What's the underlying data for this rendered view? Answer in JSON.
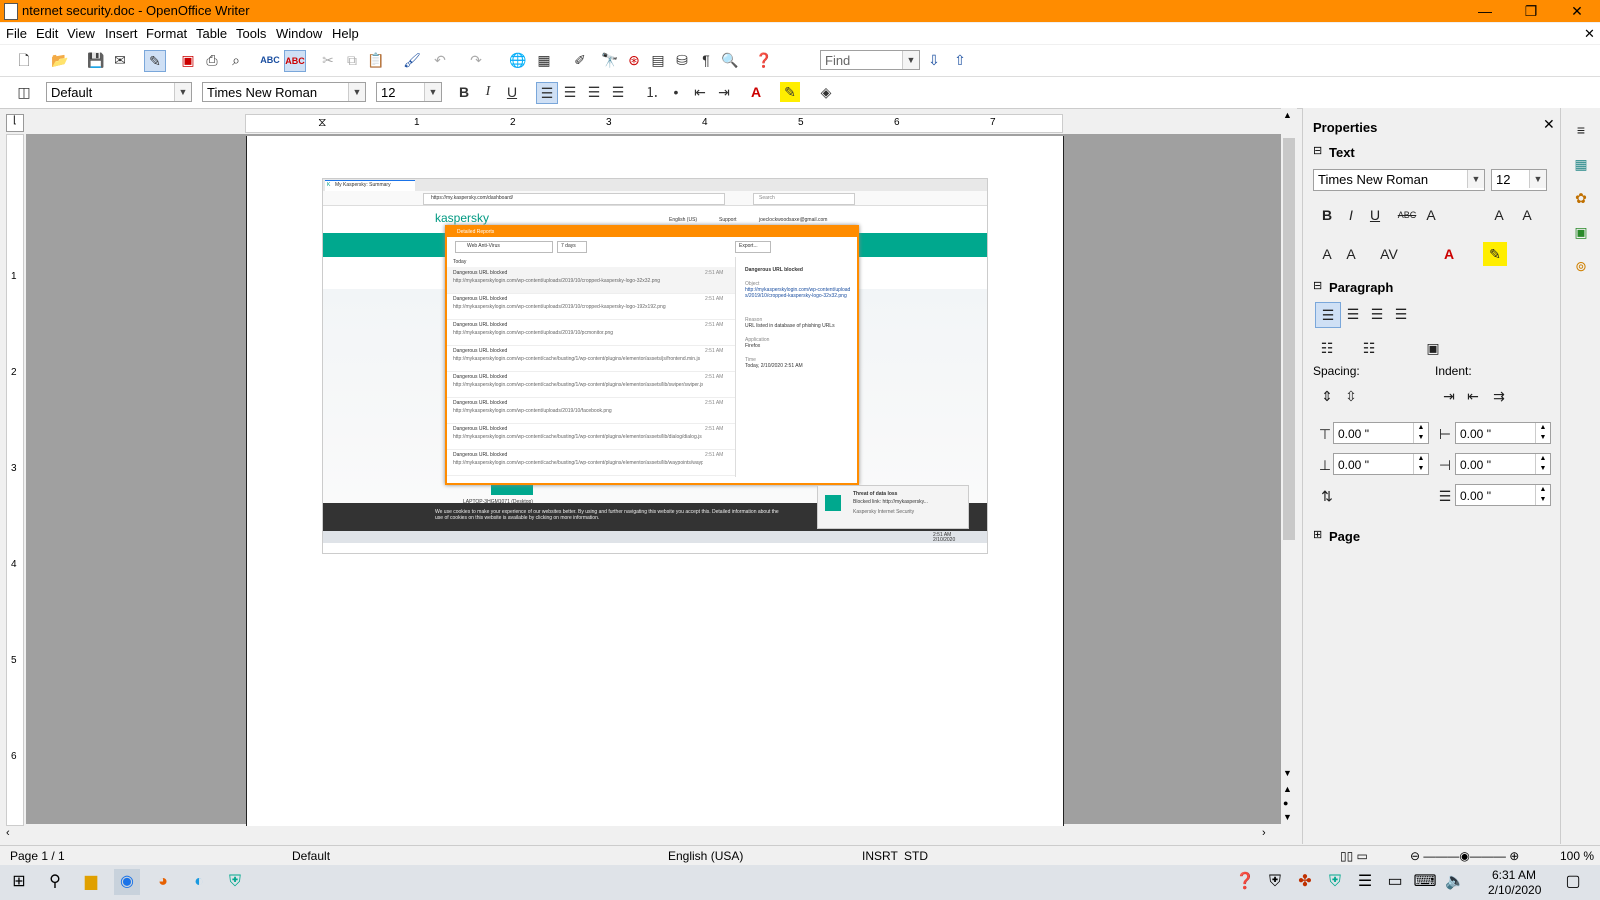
{
  "window": {
    "title": "nternet security.doc - OpenOffice Writer",
    "minimize": "—",
    "maximize": "❐",
    "close": "✕",
    "doc_close": "✕"
  },
  "menu": [
    "File",
    "Edit",
    "View",
    "Insert",
    "Format",
    "Table",
    "Tools",
    "Window",
    "Help"
  ],
  "toolbar1": {
    "find_placeholder": "Find"
  },
  "toolbar2": {
    "style": "Default",
    "font": "Times New Roman",
    "size": "12",
    "bold": "B",
    "italic": "I",
    "underline": "U"
  },
  "ruler": {
    "ticks": [
      "1",
      "2",
      "3",
      "4",
      "5",
      "6",
      "7"
    ],
    "vticks": [
      "1",
      "2",
      "3",
      "4",
      "5",
      "6"
    ]
  },
  "sidebar": {
    "title": "Properties",
    "text_section": "Text",
    "font": "Times New Roman",
    "size": "12",
    "paragraph_section": "Paragraph",
    "spacing_label": "Spacing:",
    "indent_label": "Indent:",
    "above": "0.00 \"",
    "below": "0.00 \"",
    "indent_before": "0.00 \"",
    "indent_after": "0.00 \"",
    "first_line": "0.00 \"",
    "page_section": "Page"
  },
  "statusbar": {
    "page": "Page 1 / 1",
    "style": "Default",
    "language": "English (USA)",
    "insert_mode": "INSRT",
    "selection_mode": "STD",
    "zoom": "100 %"
  },
  "taskbar": {
    "time": "6:31 AM",
    "date": "2/10/2020"
  },
  "embedded": {
    "tab": "My Kaspersky: Summary",
    "url": "https://my.kaspersky.com/dashboard/",
    "search": "Search",
    "brand": "kaspersky",
    "lang": "English (US)",
    "support": "Support",
    "account": "joeclockwoodsaxe@gmail.com",
    "dialog_title": "Detailed Reports",
    "filter": "Web Anti-Virus",
    "range": "7 days",
    "export": "Export...",
    "today": "Today",
    "items": [
      {
        "title": "Dangerous URL blocked",
        "url": "http://mykasperskylogin.com/wp-content/uploads/2019/10/cropped-kaspersky-logo-32x32.png",
        "time": "2:51 AM"
      },
      {
        "title": "Dangerous URL blocked",
        "url": "http://mykasperskylogin.com/wp-content/uploads/2019/10/cropped-kaspersky-logo-192x192.png",
        "time": "2:51 AM"
      },
      {
        "title": "Dangerous URL blocked",
        "url": "http://mykasperskylogin.com/wp-content/uploads/2019/10/pcmonitor.png",
        "time": "2:51 AM"
      },
      {
        "title": "Dangerous URL blocked",
        "url": "http://mykasperskylogin.com/wp-content/cache/busting/1/wp-content/plugins/elementor/assets/js/frontend.min.js",
        "time": "2:51 AM"
      },
      {
        "title": "Dangerous URL blocked",
        "url": "http://mykasperskylogin.com/wp-content/cache/busting/1/wp-content/plugins/elementor/assets/lib/swiper/swiper.js",
        "time": "2:51 AM"
      },
      {
        "title": "Dangerous URL blocked",
        "url": "http://mykasperskylogin.com/wp-content/uploads/2019/10/facebook.png",
        "time": "2:51 AM"
      },
      {
        "title": "Dangerous URL blocked",
        "url": "http://mykasperskylogin.com/wp-content/cache/busting/1/wp-content/plugins/elementor/assets/lib/dialog/dialog.js",
        "time": "2:51 AM"
      },
      {
        "title": "Dangerous URL blocked",
        "url": "http://mykasperskylogin.com/wp-content/cache/busting/1/wp-content/plugins/elementor/assets/lib/waypoints/waypoints.js",
        "time": "2:51 AM"
      }
    ],
    "detail_title": "Dangerous URL blocked",
    "detail_object_label": "Object",
    "detail_object": "http://mykasperskylogin.com/wp-content/uploads/2019/10/cropped-kaspersky-logo-32x32.png",
    "detail_reason_label": "Reason",
    "detail_reason": "URL listed in database of phishing URLs",
    "detail_app_label": "Application",
    "detail_app": "Firefox",
    "detail_time_label": "Time",
    "detail_time": "Today, 2/10/2020 2:51 AM",
    "laptop": "LAPTOP-3HGM1071 (Desktop)",
    "cookie": "We use cookies to make your experience of our websites better. By using and further navigating this website you accept this. Detailed information about the use of cookies on this website is available by clicking on more information.",
    "toast_title": "Threat of data loss",
    "toast_body": "Blocked link: http://mykaspersky...",
    "toast_app": "Kaspersky Internet Security",
    "mini_time": "2:51 AM",
    "mini_date": "2/10/2020"
  }
}
